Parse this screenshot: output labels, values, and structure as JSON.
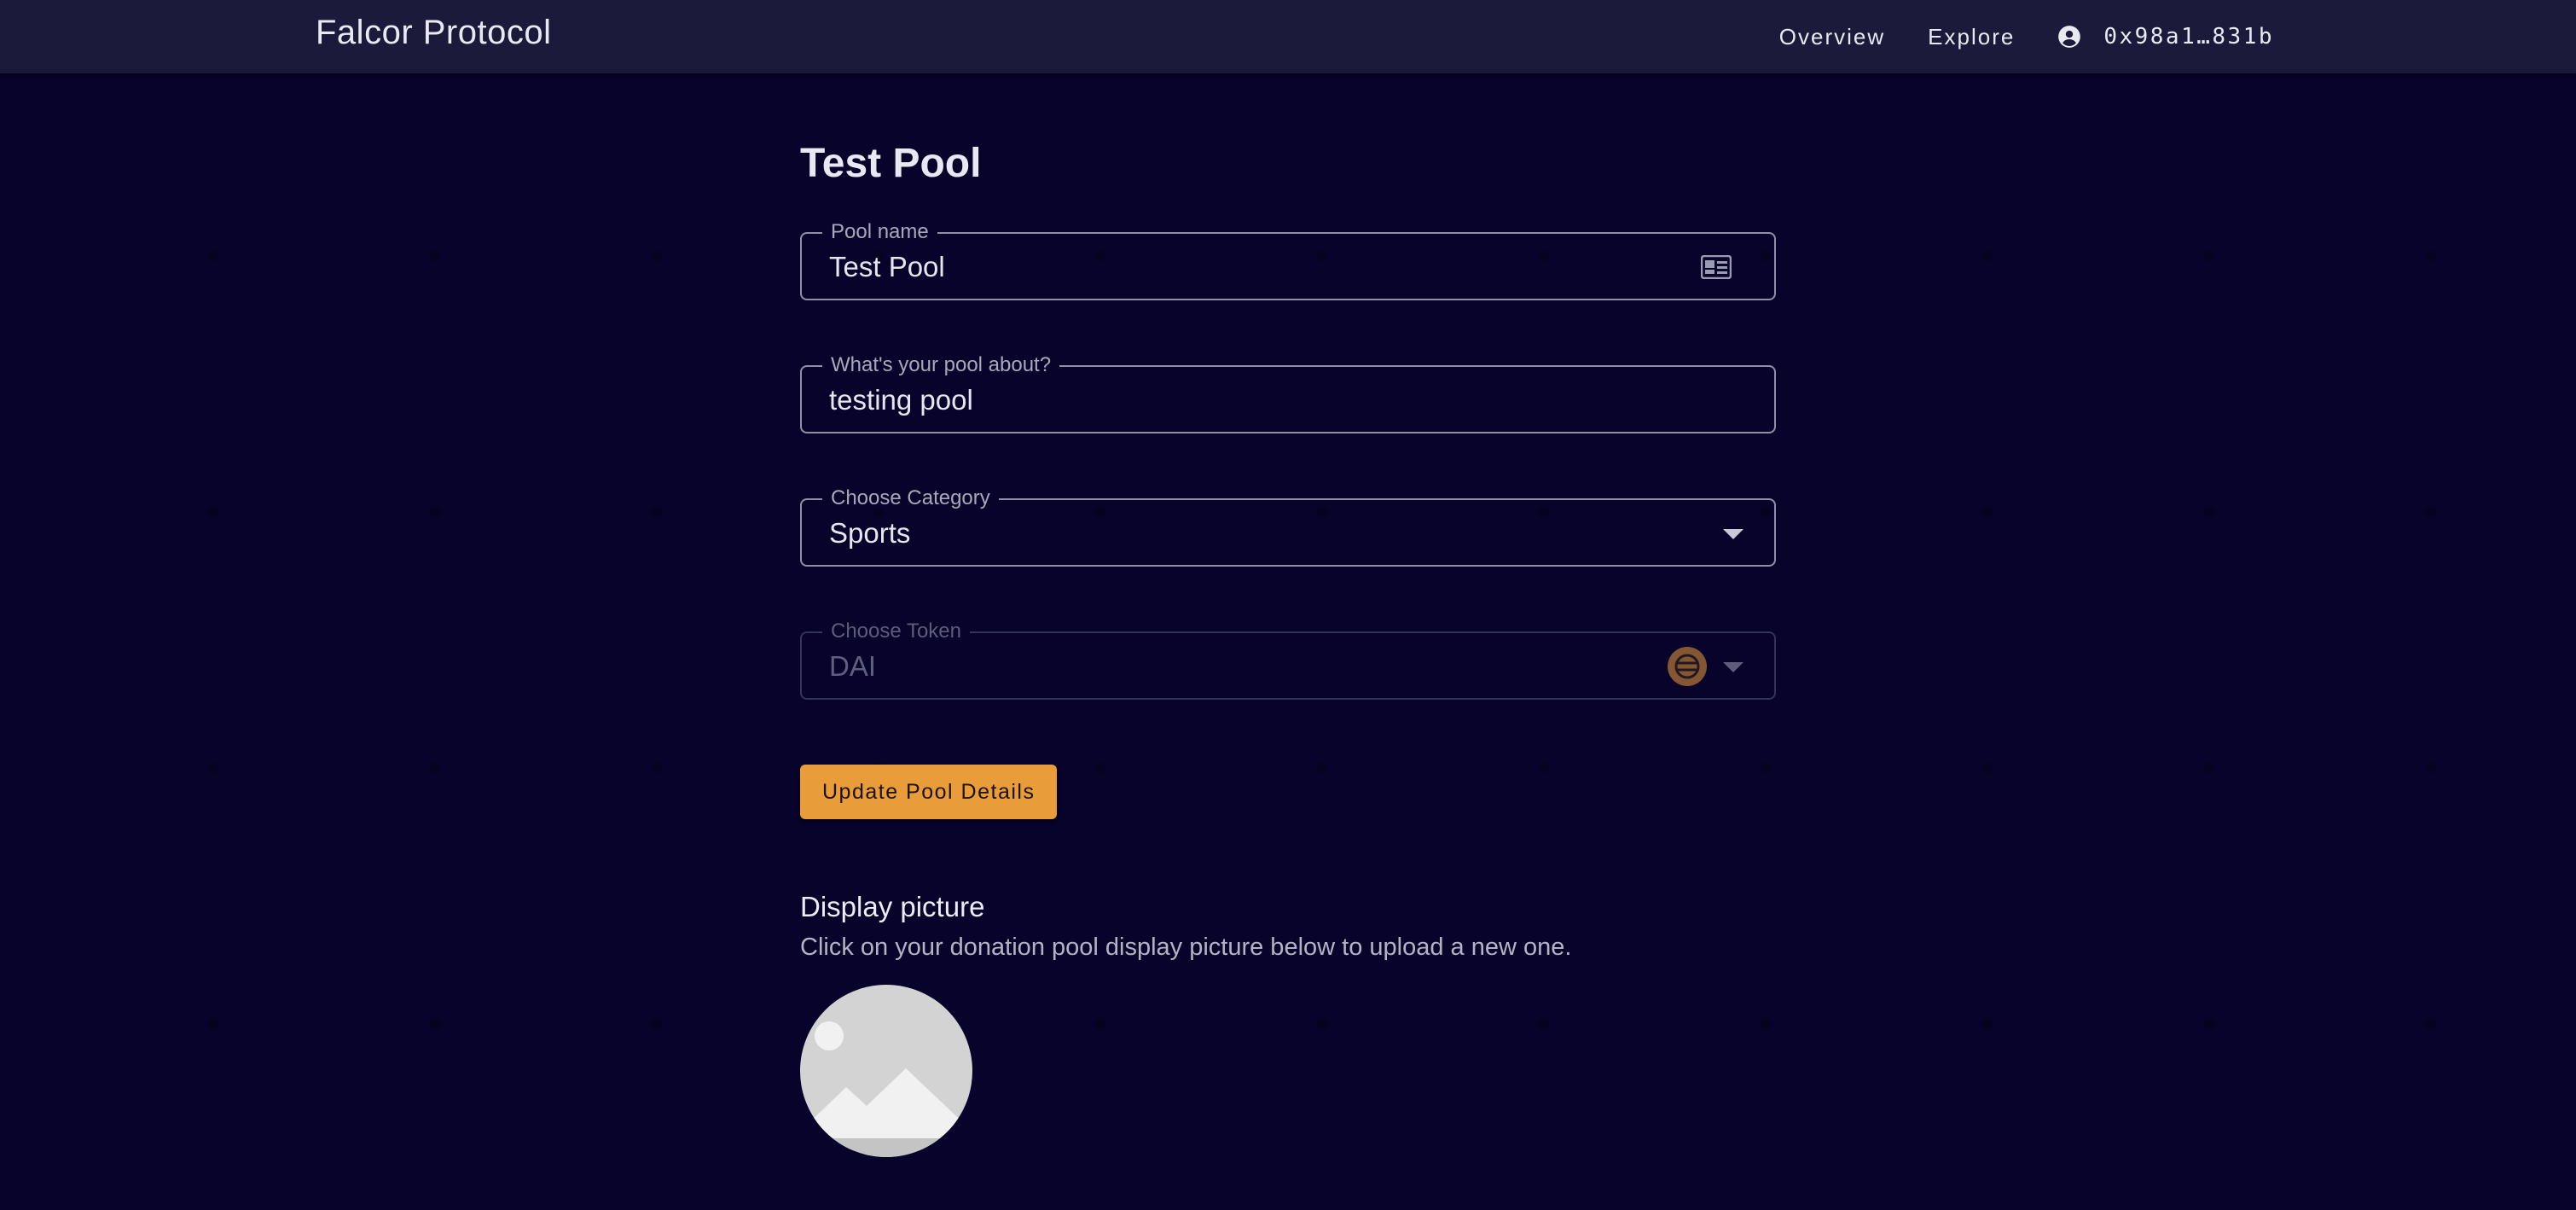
{
  "header": {
    "brand": "Falcor Protocol",
    "nav": [
      "Overview",
      "Explore"
    ],
    "account_address": "0x98a1…831b"
  },
  "page": {
    "title": "Test Pool"
  },
  "form": {
    "pool_name": {
      "label": "Pool name",
      "value": "Test Pool",
      "icon": "id-card-icon"
    },
    "about": {
      "label": "What's your pool about?",
      "value": "testing pool"
    },
    "category": {
      "label": "Choose Category",
      "value": "Sports"
    },
    "token": {
      "label": "Choose Token",
      "value": "DAI",
      "disabled": true,
      "icon": "dai-token-icon"
    },
    "submit_label": "Update Pool Details"
  },
  "display_picture": {
    "heading": "Display picture",
    "description": "Click on your donation pool display picture below to upload a new one."
  },
  "colors": {
    "background": "#07032a",
    "appbar": "#1b1a3b",
    "accent": "#e89c3a"
  }
}
